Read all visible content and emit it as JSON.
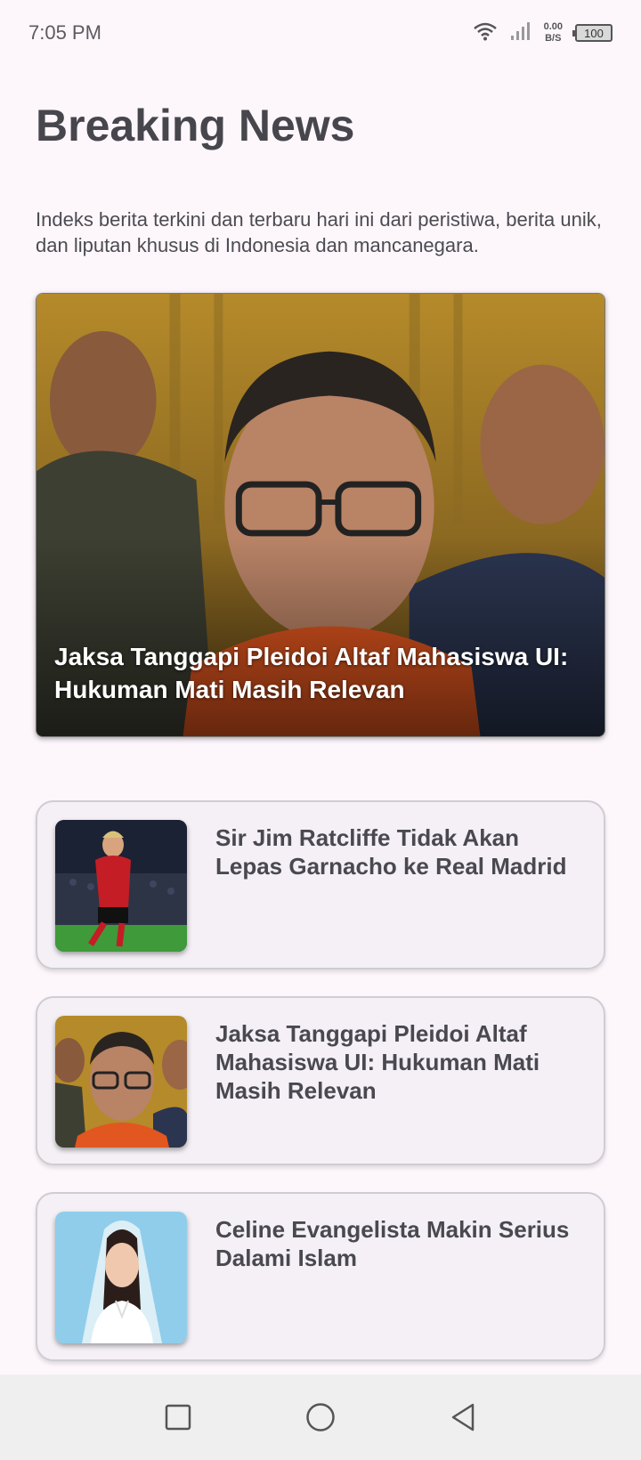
{
  "status_bar": {
    "time": "7:05 PM",
    "net_speed_value": "0.00",
    "net_speed_unit": "B/S",
    "battery": "100"
  },
  "header": {
    "title": "Breaking News",
    "description": "Indeks berita terkini dan terbaru hari ini dari peristiwa, berita unik, dan liputan khusus di Indonesia dan mancanegara."
  },
  "hero": {
    "title": "Jaksa Tanggapi Pleidoi Altaf Mahasiswa UI: Hukuman Mati Masih Relevan"
  },
  "news_items": [
    {
      "title": "Sir Jim Ratcliffe Tidak Akan Lepas Garnacho ke Real Madrid"
    },
    {
      "title": "Jaksa Tanggapi Pleidoi Altaf Mahasiswa UI: Hukuman Mati Masih Relevan"
    },
    {
      "title": "Celine Evangelista Makin Serius Dalami Islam"
    }
  ],
  "icons": {
    "wifi": "wifi-icon",
    "signal": "signal-icon",
    "battery": "battery-icon",
    "nav_recents": "square-icon",
    "nav_home": "circle-icon",
    "nav_back": "triangle-back-icon"
  }
}
